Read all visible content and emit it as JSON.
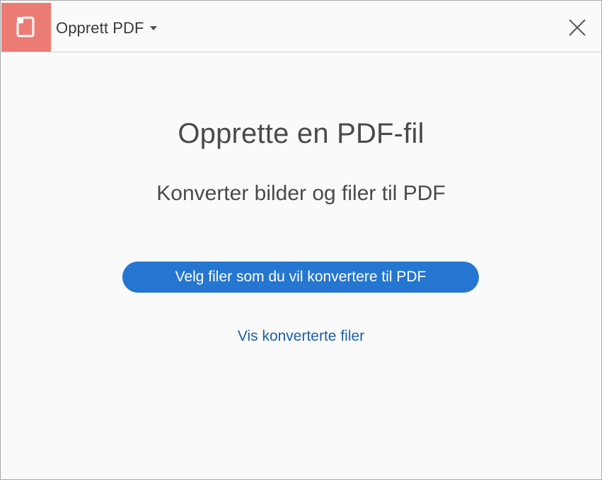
{
  "header": {
    "tool_name": "Opprett PDF",
    "tool_icon": "create-pdf-icon",
    "dropdown_icon": "caret-down-icon",
    "close_icon": "close-icon",
    "accent_color": "#ec7b74"
  },
  "main": {
    "title": "Opprette en PDF-fil",
    "subtitle": "Konverter bilder og filer til PDF",
    "primary_button_label": "Velg filer som du vil konvertere til PDF",
    "primary_button_color": "#2576d0",
    "link_label": "Vis konverterte filer"
  }
}
